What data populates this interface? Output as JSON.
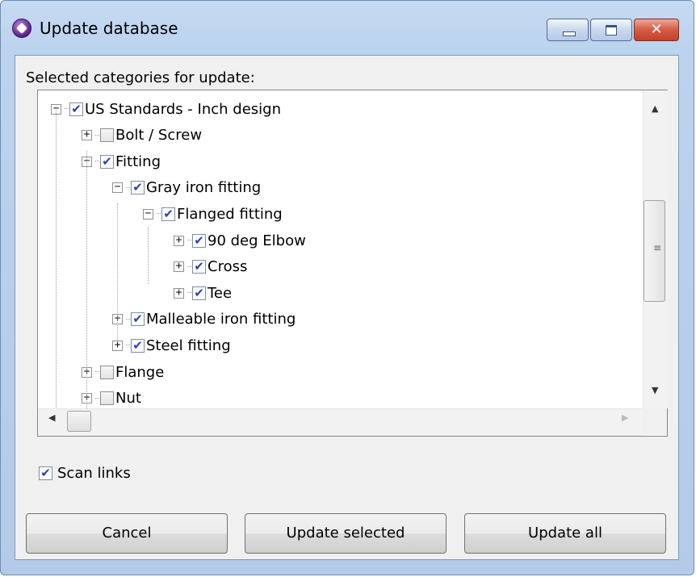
{
  "window": {
    "title": "Update database"
  },
  "section_label": "Selected categories for update:",
  "tree": [
    {
      "label": "US Standards - Inch design",
      "checked": true,
      "expander": "minus",
      "level": 0
    },
    {
      "label": "Bolt / Screw",
      "checked": false,
      "expander": "plus",
      "level": 1
    },
    {
      "label": "Fitting",
      "checked": true,
      "expander": "minus",
      "level": 1
    },
    {
      "label": "Gray iron fitting",
      "checked": true,
      "expander": "minus",
      "level": 2
    },
    {
      "label": "Flanged fitting",
      "checked": true,
      "expander": "minus",
      "level": 3
    },
    {
      "label": "90 deg Elbow",
      "checked": true,
      "expander": "plus",
      "level": 4
    },
    {
      "label": "Cross",
      "checked": true,
      "expander": "plus",
      "level": 4
    },
    {
      "label": "Tee",
      "checked": true,
      "expander": "plus",
      "level": 4
    },
    {
      "label": "Malleable iron fitting",
      "checked": true,
      "expander": "plus",
      "level": 2
    },
    {
      "label": "Steel fitting",
      "checked": true,
      "expander": "plus",
      "level": 2
    },
    {
      "label": "Flange",
      "checked": false,
      "expander": "plus",
      "level": 1
    },
    {
      "label": "Nut",
      "checked": false,
      "expander": "plus",
      "level": 1
    }
  ],
  "scan_links": {
    "label": "Scan links",
    "checked": true
  },
  "buttons": {
    "cancel": "Cancel",
    "update_selected": "Update selected",
    "update_all": "Update all"
  }
}
